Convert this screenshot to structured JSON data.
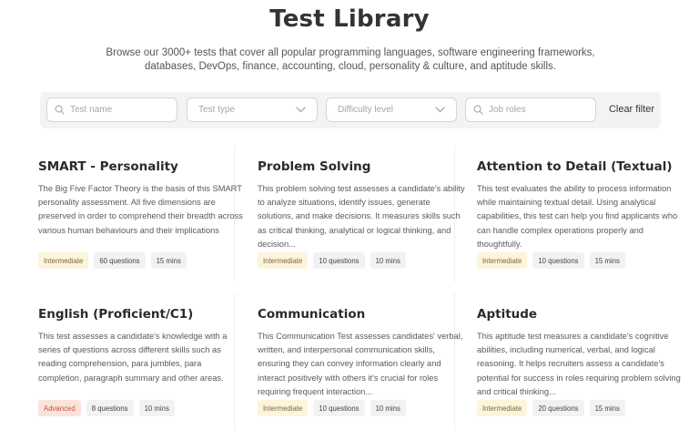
{
  "header": {
    "title": "Test Library",
    "subtitle": "Browse our 3000+ tests that cover all popular programming languages, software engineering frameworks, databases, DevOps, finance, accounting, cloud, personality & culture, and aptitude skills."
  },
  "filters": {
    "test_name_placeholder": "Test name",
    "test_type_placeholder": "Test type",
    "difficulty_placeholder": "Difficulty level",
    "job_roles_placeholder": "Job roles",
    "clear_label": "Clear filter"
  },
  "cards": [
    {
      "title": "SMART - Personality",
      "description": "The Big Five Factor Theory is the basis of this SMART personality assessment. All five dimensions are preserved in order to comprehend their breadth across various human behaviours and their implications",
      "level": "Intermediate",
      "questions": "60 questions",
      "duration": "15 mins"
    },
    {
      "title": "Problem Solving",
      "description": "This problem solving test assesses a candidate's ability to analyze situations, identify issues, generate solutions, and make decisions. It measures skills such as critical thinking, analytical or logical thinking, and decision...",
      "level": "Intermediate",
      "questions": "10 questions",
      "duration": "10 mins"
    },
    {
      "title": "Attention to Detail (Textual)",
      "description": "This test evaluates the ability to process information while maintaining textual detail. Using analytical capabilities, this test can help you find applicants who can handle complex operations properly and thoughtfully.",
      "level": "Intermediate",
      "questions": "10 questions",
      "duration": "15 mins"
    },
    {
      "title": "English (Proficient/C1)",
      "description": "This test assesses a candidate's knowledge with a series of questions across different skills such as reading comprehension, para jumbles, para completion, paragraph summary and other areas.",
      "level": "Advanced",
      "questions": "8 questions",
      "duration": "10 mins"
    },
    {
      "title": "Communication",
      "description": "This Communication Test assesses candidates' verbal, written, and interpersonal communication skills, ensuring they can convey information clearly and interact positively with others it's crucial for roles requiring frequent interaction...",
      "level": "Intermediate",
      "questions": "10 questions",
      "duration": "10 mins"
    },
    {
      "title": "Aptitude",
      "description": "This aptitude test measures a candidate's cognitive abilities, including numerical, verbal, and logical reasoning. It helps recruiters assess a candidate's potential for success in roles requiring problem solving and critical thinking...",
      "level": "Intermediate",
      "questions": "20 questions",
      "duration": "15 mins"
    }
  ],
  "colors": {
    "intermediate_bg": "#fdf4dc",
    "advanced_bg": "#fbe3dc",
    "advanced_text": "#c0573c"
  }
}
